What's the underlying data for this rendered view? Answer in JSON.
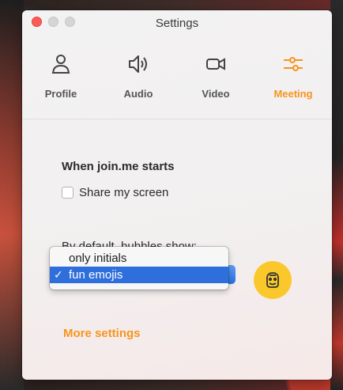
{
  "window": {
    "title": "Settings"
  },
  "tabs": [
    {
      "label": "Profile",
      "icon": "person-icon",
      "active": false
    },
    {
      "label": "Audio",
      "icon": "speaker-icon",
      "active": false
    },
    {
      "label": "Video",
      "icon": "camera-icon",
      "active": false
    },
    {
      "label": "Meeting",
      "icon": "sliders-icon",
      "active": true
    }
  ],
  "meeting": {
    "start_heading": "When join.me starts",
    "share_screen": {
      "label": "Share my screen",
      "checked": false
    },
    "bubbles_label": "By default, bubbles show:",
    "bubbles_options": [
      {
        "label": "only initials",
        "selected": false
      },
      {
        "label": "fun emojis",
        "selected": true
      }
    ],
    "selected_marker": "✓",
    "more_settings": "More settings"
  },
  "colors": {
    "accent": "#f7941d",
    "selection_blue": "#2f6fdc",
    "emoji_yellow": "#fbc82b",
    "close_red": "#fc5c57"
  }
}
